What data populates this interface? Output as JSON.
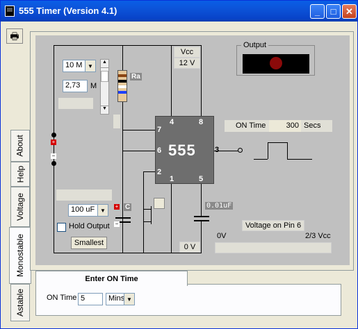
{
  "window": {
    "title": "555 Timer  (Version 4.1)"
  },
  "title_buttons": {
    "minimize": "_",
    "maximize": "□",
    "close": "✕"
  },
  "vertical_tabs": [
    "About",
    "Help",
    "Voltage",
    "Monostable",
    "Astable"
  ],
  "circuit": {
    "vcc_label": "Vcc",
    "vcc_value": "12 V",
    "chip_label": "555",
    "pins": {
      "p4": "4",
      "p8": "8",
      "p7": "7",
      "p6": "6",
      "p3": "3",
      "p2": "2",
      "p1": "1",
      "p5": "5"
    },
    "resistor_label": "Ra",
    "cap_label": "C",
    "cap2_value": "0.01uF",
    "zero_v": "0 V",
    "plus_sign": "+",
    "minus_sign": "−"
  },
  "resistor_controls": {
    "range": "10 M",
    "value": "2,73",
    "unit": "M"
  },
  "capacitor_controls": {
    "value": "100 uF",
    "hold_output": "Hold Output",
    "smallest": "Smallest"
  },
  "output": {
    "label": "Output"
  },
  "on_time": {
    "label": "ON Time",
    "value": "300",
    "unit": "Secs"
  },
  "voltage_pin6": {
    "label": "Voltage on Pin 6",
    "min": "0V",
    "max": "2/3 Vcc"
  },
  "bottom": {
    "tab_label": "Enter ON Time",
    "on_time_label": "ON Time",
    "on_time_value": "5",
    "unit": "Mins"
  }
}
